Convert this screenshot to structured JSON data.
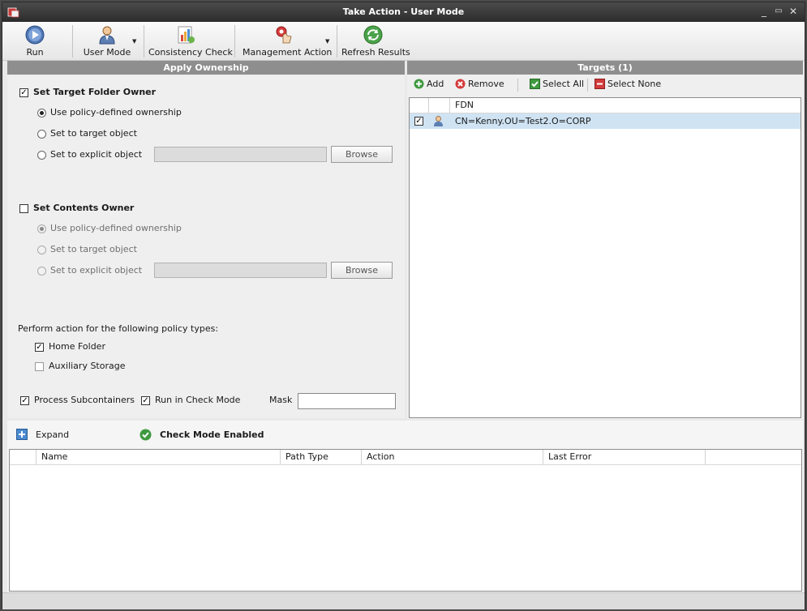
{
  "window": {
    "title": "Take Action - User Mode"
  },
  "toolbar": {
    "run": "Run",
    "user_mode": "User Mode",
    "consistency_check": "Consistency Check",
    "management_action": "Management Action",
    "refresh_results": "Refresh Results"
  },
  "ownership": {
    "header": "Apply Ownership",
    "target_folder_owner": {
      "label": "Set Target Folder Owner",
      "checked": true,
      "options": [
        "Use policy-defined ownership",
        "Set to target object",
        "Set to explicit object"
      ],
      "selected": "Use policy-defined ownership",
      "browse": "Browse",
      "explicit_value": ""
    },
    "contents_owner": {
      "label": "Set Contents Owner",
      "checked": false,
      "options": [
        "Use policy-defined ownership",
        "Set to target object",
        "Set to explicit object"
      ],
      "selected": "Use policy-defined ownership",
      "browse": "Browse",
      "explicit_value": ""
    },
    "policy_types_label": "Perform action for the following policy types:",
    "home_folder": {
      "label": "Home Folder",
      "checked": true
    },
    "auxiliary_storage": {
      "label": "Auxiliary Storage",
      "checked": false
    },
    "process_subcontainers": {
      "label": "Process Subcontainers",
      "checked": true
    },
    "run_in_check_mode": {
      "label": "Run in Check Mode",
      "checked": true
    },
    "mask": {
      "label": "Mask",
      "value": ""
    }
  },
  "targets": {
    "header": "Targets  (1)",
    "add": "Add",
    "remove": "Remove",
    "select_all": "Select All",
    "select_none": "Select None",
    "column_fdn": "FDN",
    "rows": [
      {
        "checked": true,
        "fdn": "CN=Kenny.OU=Test2.O=CORP"
      }
    ]
  },
  "results": {
    "expand": "Expand",
    "status": "Check Mode Enabled",
    "columns": [
      "Name",
      "Path Type",
      "Action",
      "Last Error"
    ]
  },
  "colors": {
    "header": "#8e8e8e",
    "selection": "#cfe3f3",
    "titlebar": "#333333"
  }
}
